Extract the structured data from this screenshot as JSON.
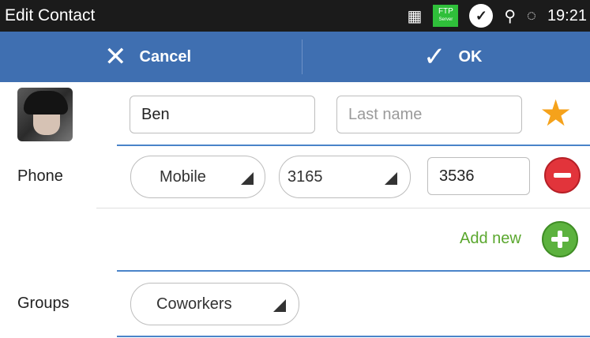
{
  "status_bar": {
    "title": "Edit Contact",
    "time": "19:21",
    "ftp_label": "FTP",
    "ftp_sub": "Server"
  },
  "action_bar": {
    "cancel_label": "Cancel",
    "ok_label": "OK"
  },
  "name": {
    "first_value": "Ben",
    "last_placeholder": "Last name"
  },
  "phone": {
    "label": "Phone",
    "type": "Mobile",
    "prefix": "3165",
    "number": "3536"
  },
  "add_new": {
    "label": "Add new"
  },
  "groups": {
    "label": "Groups",
    "value": "Coworkers"
  },
  "colors": {
    "action_bar": "#3f6fb1",
    "accent_line": "#4a84c9",
    "star": "#f5a21b",
    "remove": "#e2343b",
    "add": "#5cb23e",
    "add_text": "#5aa72e"
  },
  "icons": [
    "sim-icon",
    "ftp-server-icon",
    "chat-icon",
    "usb-icon",
    "sync-icon",
    "close-icon",
    "check-icon",
    "star-icon",
    "remove-icon",
    "add-icon",
    "avatar"
  ]
}
